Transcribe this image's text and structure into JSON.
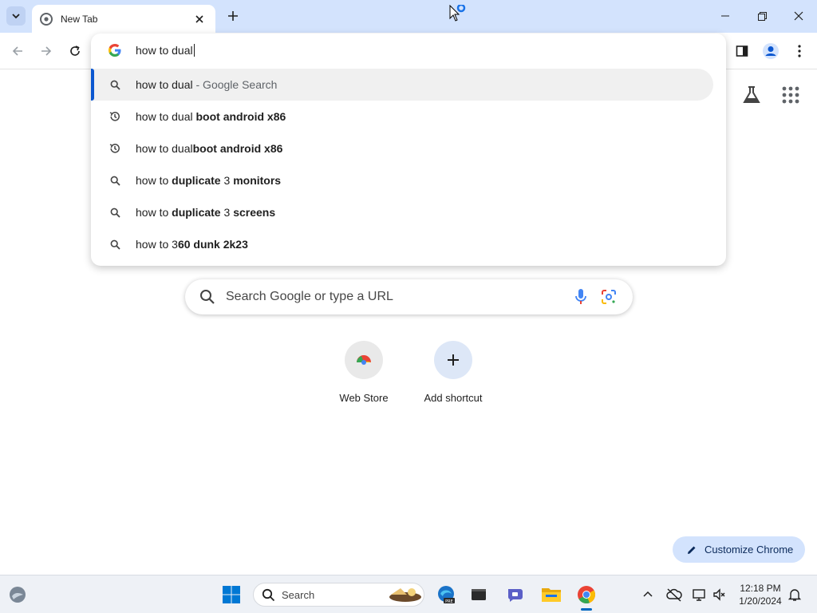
{
  "browser": {
    "tab_title": "New Tab",
    "new_tab_icon": "plus-icon",
    "window_controls": [
      "minimize-icon",
      "maximize-icon",
      "close-icon"
    ]
  },
  "omnibox": {
    "input_value": "how to dual",
    "suggestions": [
      {
        "icon": "search-icon",
        "prefix": "how to dual",
        "bold": "",
        "suffix": "",
        "sep": " - Google Search"
      },
      {
        "icon": "history-icon",
        "prefix": "how to dual ",
        "bold": "boot android x86",
        "suffix": "",
        "sep": ""
      },
      {
        "icon": "history-icon",
        "prefix": "how to dual",
        "bold": "boot android x86",
        "suffix": "",
        "sep": ""
      },
      {
        "icon": "search-icon",
        "prefix": "how to ",
        "bold": "duplicate",
        "mid": " 3 ",
        "bold2": "monitors"
      },
      {
        "icon": "search-icon",
        "prefix": "how to ",
        "bold": "duplicate",
        "mid": " 3 ",
        "bold2": "screens"
      },
      {
        "icon": "search-icon",
        "prefix": "how to 3",
        "bold": "60 dunk 2k23",
        "suffix": "",
        "sep": ""
      }
    ]
  },
  "ntp": {
    "search_placeholder": "Search Google or type a URL",
    "shortcuts": [
      {
        "label": "Web Store",
        "icon": "chrome-web-store-icon"
      },
      {
        "label": "Add shortcut",
        "icon": "plus-icon"
      }
    ],
    "customize_label": "Customize Chrome"
  },
  "taskbar": {
    "search_label": "Search",
    "time": "12:18 PM",
    "date": "1/20/2024"
  },
  "colors": {
    "tab_strip": "#d3e3fd",
    "accent": "#0b57d0",
    "taskbar": "#eef1f6"
  }
}
